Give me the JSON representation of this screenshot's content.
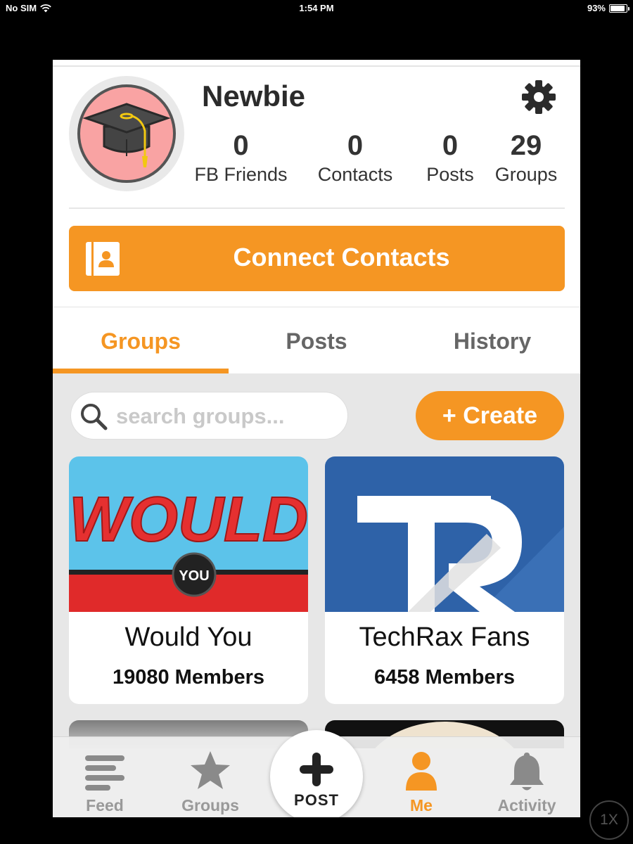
{
  "status_bar": {
    "carrier": "No SIM",
    "time": "1:54 PM",
    "battery": "93%",
    "battery_level": 0.93
  },
  "profile": {
    "name": "Newbie",
    "avatar_icon": "graduation-cap-icon",
    "settings_icon": "gear-icon",
    "stats": [
      {
        "value": "0",
        "label": "FB Friends"
      },
      {
        "value": "0",
        "label": "Contacts"
      },
      {
        "value": "0",
        "label": "Posts"
      },
      {
        "value": "29",
        "label": "Groups"
      }
    ]
  },
  "connect_contacts": {
    "label": "Connect Contacts",
    "icon": "address-book-icon"
  },
  "tabs": [
    {
      "label": "Groups",
      "active": true
    },
    {
      "label": "Posts",
      "active": false
    },
    {
      "label": "History",
      "active": false
    }
  ],
  "search": {
    "placeholder": "search groups...",
    "value": ""
  },
  "create_button": {
    "label": "+ Create"
  },
  "groups": [
    {
      "title": "Would You",
      "members": "19080 Members",
      "banner_word": "WOULD",
      "badge": "YOU"
    },
    {
      "title": "TechRax Fans",
      "members": "6458 Members",
      "logo_text": "TR"
    }
  ],
  "tab_bar": {
    "items": [
      {
        "label": "Feed",
        "icon": "feed-icon"
      },
      {
        "label": "Groups",
        "icon": "star-icon"
      },
      {
        "label": "Me",
        "icon": "person-icon",
        "active": true
      },
      {
        "label": "Activity",
        "icon": "bell-icon"
      }
    ],
    "post": {
      "label": "POST",
      "icon": "plus-icon"
    }
  },
  "zoom_badge": "1X",
  "colors": {
    "accent": "#f59623",
    "avatar_bg": "#f9a3a3",
    "would_you_red": "#e02a2a",
    "would_you_blue": "#5cc3ea",
    "techrax_blue": "#2e62a8"
  }
}
